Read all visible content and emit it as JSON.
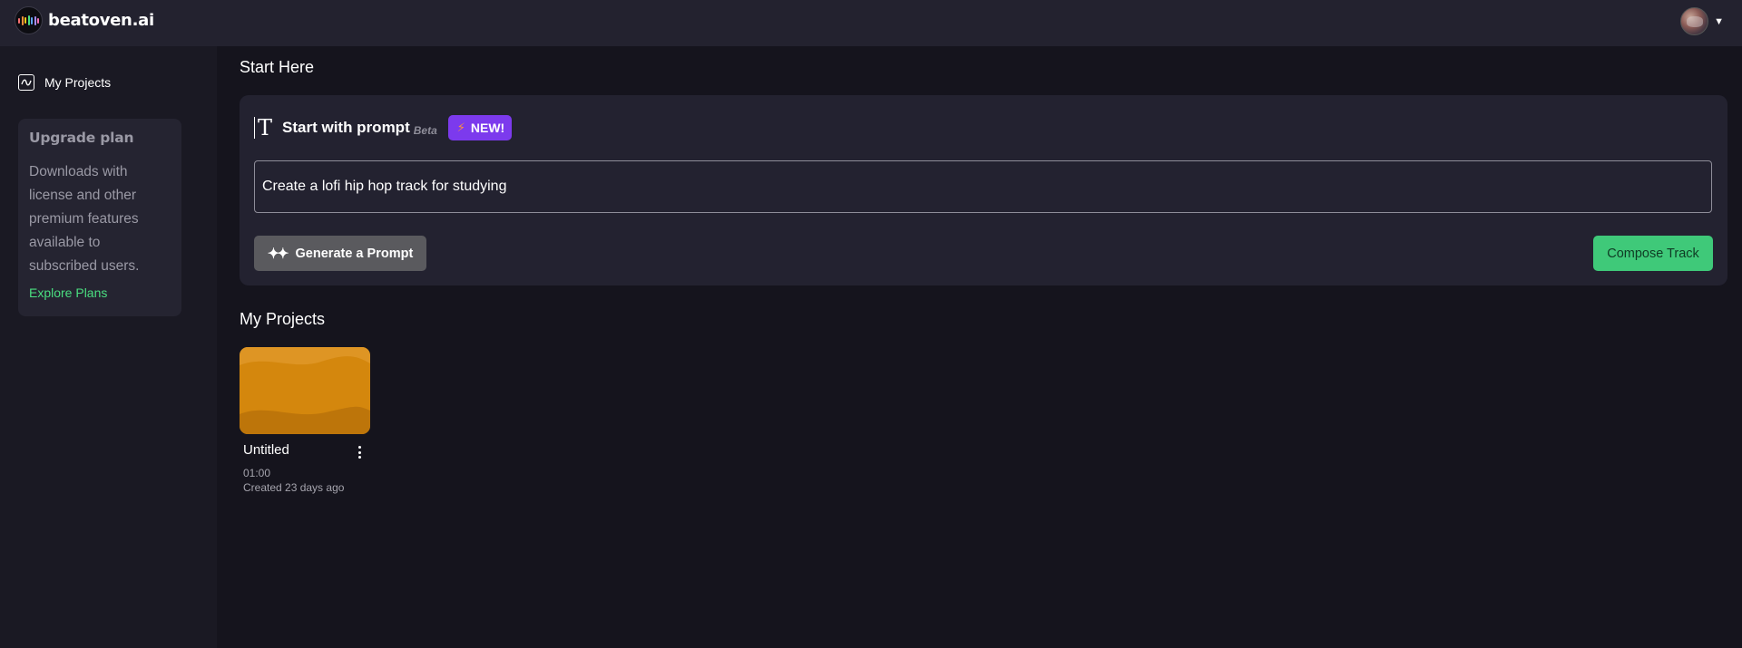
{
  "header": {
    "logo_text": "beatoven.ai",
    "logo_bar_colors": [
      "#f87171",
      "#fb923c",
      "#facc15",
      "#4ade80",
      "#60a5fa",
      "#a78bfa",
      "#f472b6"
    ],
    "avatar_icon": "user-avatar",
    "menu_icon": "chevron-down-icon"
  },
  "sidebar": {
    "items": [
      {
        "label": "My Projects",
        "icon": "chart-square-icon"
      }
    ],
    "upgrade": {
      "title": "Upgrade plan",
      "description": "Downloads with license and other premium features available to subscribed users.",
      "link_label": "Explore Plans",
      "link_color": "#4ade80"
    }
  },
  "main": {
    "start_title": "Start Here",
    "prompt": {
      "label": "Start with prompt",
      "beta": "Beta",
      "badge": "NEW!",
      "badge_color": "#7c3aed",
      "input_value": "Create a lofi hip hop track for studying",
      "generate_label": "Generate a Prompt",
      "compose_label": "Compose Track",
      "compose_color": "#3fc979"
    },
    "projects_title": "My Projects",
    "projects": [
      {
        "name": "Untitled",
        "duration": "01:00",
        "created": "Created 23 days ago",
        "thumb_color": "#d4870d"
      }
    ]
  }
}
